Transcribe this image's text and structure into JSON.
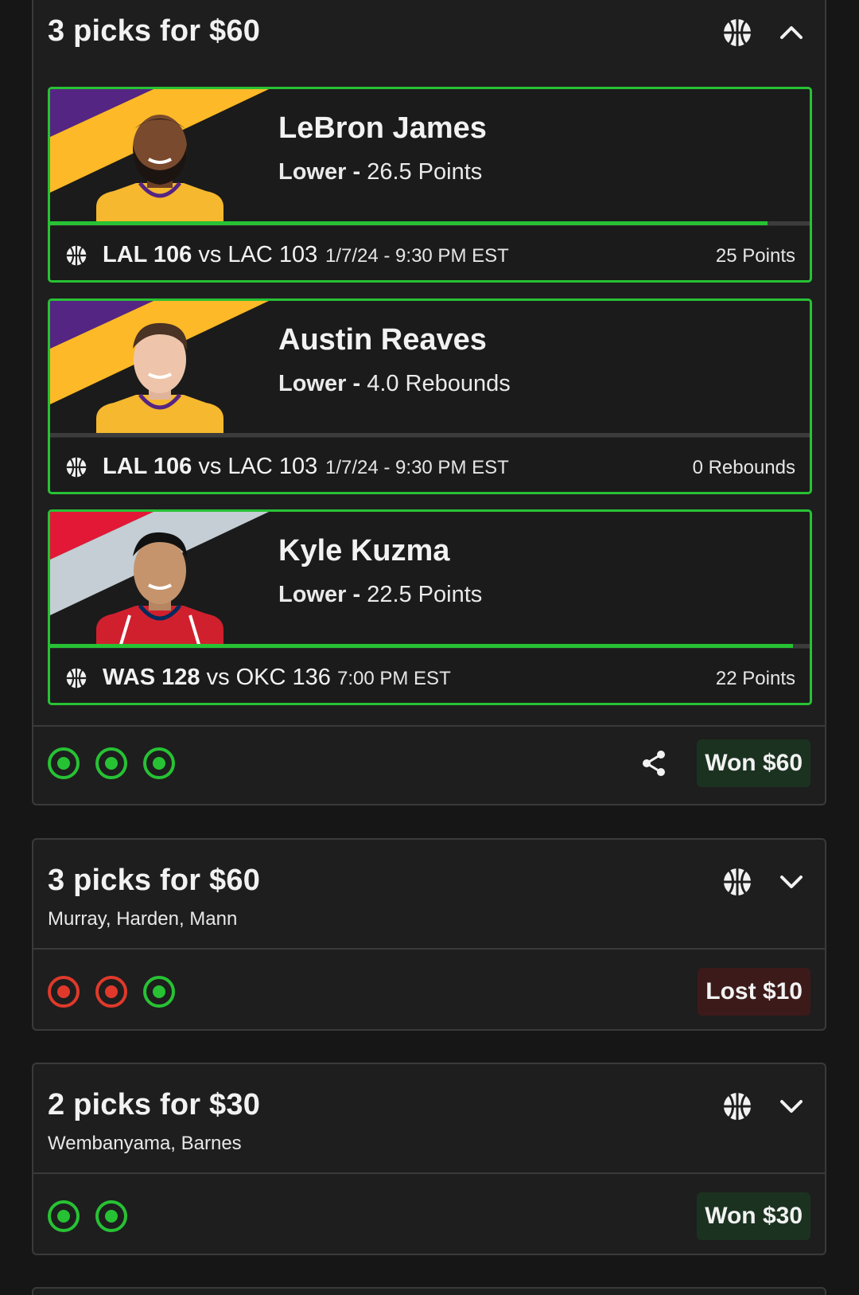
{
  "cards": [
    {
      "title": "3 picks for $60",
      "expanded": true,
      "picks": [
        {
          "name": "LeBron James",
          "direction": "Lower -",
          "line": "26.5 Points",
          "team1": "LAL 106",
          "vs": "vs",
          "team2": "LAC 103",
          "time": "1/7/24 - 9:30 PM EST",
          "stat": "25 Points",
          "progress": 0.944,
          "colors": {
            "primary": "#552583",
            "secondary": "#FDB927",
            "jersey": "#F5B82E",
            "trim": "#552583"
          }
        },
        {
          "name": "Austin Reaves",
          "direction": "Lower -",
          "line": "4.0 Rebounds",
          "team1": "LAL 106",
          "vs": "vs",
          "team2": "LAC 103",
          "time": "1/7/24 - 9:30 PM EST",
          "stat": "0 Rebounds",
          "progress": 0,
          "colors": {
            "primary": "#552583",
            "secondary": "#FDB927",
            "jersey": "#F5B82E",
            "trim": "#552583"
          }
        },
        {
          "name": "Kyle Kuzma",
          "direction": "Lower -",
          "line": "22.5 Points",
          "team1": "WAS 128",
          "vs": "vs",
          "team2": "OKC 136",
          "time": "7:00 PM EST",
          "stat": "22 Points",
          "progress": 0.978,
          "colors": {
            "primary": "#E31837",
            "secondary": "#C4CED4",
            "jersey": "#D0202E",
            "trim": "#002B5C"
          }
        }
      ],
      "results": [
        "win",
        "win",
        "win"
      ],
      "outcome": "Won $60",
      "outcome_type": "won"
    },
    {
      "title": "3 picks for $60",
      "subtitle": "Murray, Harden, Mann",
      "expanded": false,
      "results": [
        "loss",
        "loss",
        "win"
      ],
      "outcome": "Lost $10",
      "outcome_type": "lost"
    },
    {
      "title": "2 picks for $30",
      "subtitle": "Wembanyama, Barnes",
      "expanded": false,
      "results": [
        "win",
        "win"
      ],
      "outcome": "Won $30",
      "outcome_type": "won"
    }
  ],
  "icons": {
    "sport": "basketball-icon",
    "collapse": "chevron-up-icon",
    "expand": "chevron-down-icon",
    "share": "share-icon"
  },
  "colors": {
    "win": "#27c234",
    "loss": "#e0392b",
    "won_bg": "#1b3220",
    "lost_bg": "#3d1a1a"
  }
}
